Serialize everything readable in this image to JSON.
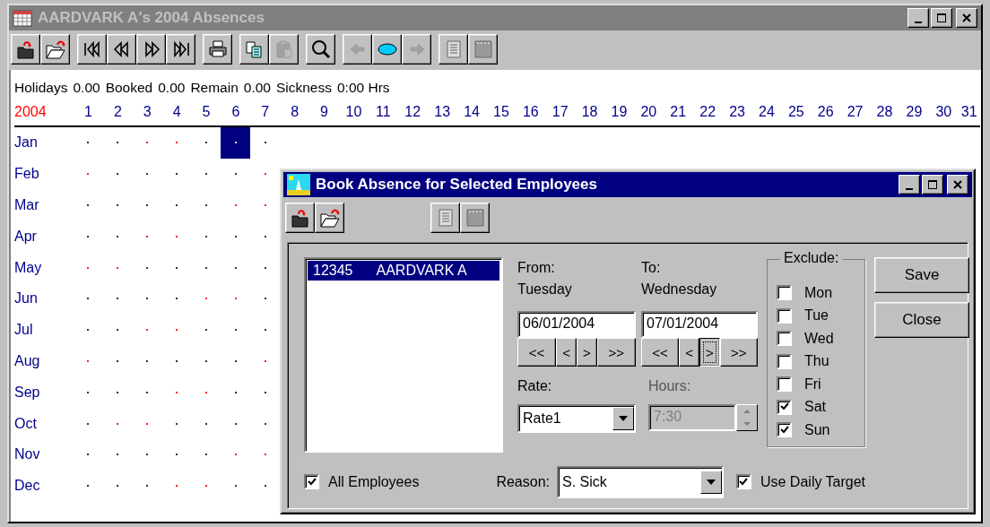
{
  "window": {
    "title": "AARDVARK A's 2004 Absences",
    "active": false
  },
  "toolbar": [
    [
      {
        "disabled": false
      },
      {
        "disabled": false
      }
    ],
    [
      {
        "disabled": false
      },
      {
        "disabled": false
      },
      {
        "disabled": false
      },
      {
        "disabled": false
      }
    ],
    [
      {
        "disabled": false
      }
    ],
    [
      {
        "disabled": false
      },
      {
        "disabled": true
      }
    ],
    [
      {
        "disabled": false
      }
    ],
    [
      {
        "disabled": true
      },
      {
        "disabled": false
      },
      {
        "disabled": true
      }
    ],
    [
      {
        "disabled": false
      },
      {
        "disabled": false
      }
    ]
  ],
  "summary": [
    {
      "label": "Holidays",
      "value": "0.00"
    },
    {
      "label": "Booked",
      "value": "0.00"
    },
    {
      "label": "Remain",
      "value": "0.00"
    },
    {
      "label": "Sickness",
      "value": "0:00 Hrs"
    }
  ],
  "calendar": {
    "year": "2004",
    "days": [
      "1",
      "2",
      "3",
      "4",
      "5",
      "6",
      "7",
      "8",
      "9",
      "10",
      "11",
      "12",
      "13",
      "14",
      "15",
      "16",
      "17",
      "18",
      "19",
      "20",
      "21",
      "22",
      "23",
      "24",
      "25",
      "26",
      "27",
      "28",
      "29",
      "30",
      "31"
    ],
    "months": [
      {
        "name": "Jan",
        "days": [
          {
            "weekend": false,
            "selected": false
          },
          {
            "weekend": false,
            "selected": false
          },
          {
            "weekend": true,
            "selected": false
          },
          {
            "weekend": true,
            "selected": false
          },
          {
            "weekend": false,
            "selected": false
          },
          {
            "weekend": false,
            "selected": true
          },
          {
            "weekend": false,
            "selected": false
          }
        ]
      },
      {
        "name": "Feb",
        "days": [
          {
            "weekend": true,
            "selected": false
          },
          {
            "weekend": false,
            "selected": false
          },
          {
            "weekend": false,
            "selected": false
          },
          {
            "weekend": false,
            "selected": false
          },
          {
            "weekend": false,
            "selected": false
          },
          {
            "weekend": false,
            "selected": false
          },
          {
            "weekend": true,
            "selected": false
          }
        ]
      },
      {
        "name": "Mar",
        "days": [
          {
            "weekend": false,
            "selected": false
          },
          {
            "weekend": false,
            "selected": false
          },
          {
            "weekend": false,
            "selected": false
          },
          {
            "weekend": false,
            "selected": false
          },
          {
            "weekend": false,
            "selected": false
          },
          {
            "weekend": true,
            "selected": false
          },
          {
            "weekend": true,
            "selected": false
          }
        ]
      },
      {
        "name": "Apr",
        "days": [
          {
            "weekend": false,
            "selected": false
          },
          {
            "weekend": false,
            "selected": false
          },
          {
            "weekend": true,
            "selected": false
          },
          {
            "weekend": true,
            "selected": false
          },
          {
            "weekend": false,
            "selected": false
          },
          {
            "weekend": false,
            "selected": false
          },
          {
            "weekend": false,
            "selected": false
          }
        ]
      },
      {
        "name": "May",
        "days": [
          {
            "weekend": true,
            "selected": false
          },
          {
            "weekend": true,
            "selected": false
          },
          {
            "weekend": false,
            "selected": false
          },
          {
            "weekend": false,
            "selected": false
          },
          {
            "weekend": false,
            "selected": false
          },
          {
            "weekend": false,
            "selected": false
          },
          {
            "weekend": false,
            "selected": false
          }
        ]
      },
      {
        "name": "Jun",
        "days": [
          {
            "weekend": false,
            "selected": false
          },
          {
            "weekend": false,
            "selected": false
          },
          {
            "weekend": false,
            "selected": false
          },
          {
            "weekend": false,
            "selected": false
          },
          {
            "weekend": true,
            "selected": false
          },
          {
            "weekend": true,
            "selected": false
          },
          {
            "weekend": false,
            "selected": false
          }
        ]
      },
      {
        "name": "Jul",
        "days": [
          {
            "weekend": false,
            "selected": false
          },
          {
            "weekend": false,
            "selected": false
          },
          {
            "weekend": true,
            "selected": false
          },
          {
            "weekend": true,
            "selected": false
          },
          {
            "weekend": false,
            "selected": false
          },
          {
            "weekend": false,
            "selected": false
          },
          {
            "weekend": false,
            "selected": false
          }
        ]
      },
      {
        "name": "Aug",
        "days": [
          {
            "weekend": true,
            "selected": false
          },
          {
            "weekend": false,
            "selected": false
          },
          {
            "weekend": false,
            "selected": false
          },
          {
            "weekend": false,
            "selected": false
          },
          {
            "weekend": false,
            "selected": false
          },
          {
            "weekend": false,
            "selected": false
          },
          {
            "weekend": true,
            "selected": false
          }
        ]
      },
      {
        "name": "Sep",
        "days": [
          {
            "weekend": false,
            "selected": false
          },
          {
            "weekend": false,
            "selected": false
          },
          {
            "weekend": false,
            "selected": false
          },
          {
            "weekend": true,
            "selected": false
          },
          {
            "weekend": true,
            "selected": false
          },
          {
            "weekend": false,
            "selected": false
          },
          {
            "weekend": false,
            "selected": false
          }
        ]
      },
      {
        "name": "Oct",
        "days": [
          {
            "weekend": false,
            "selected": false
          },
          {
            "weekend": true,
            "selected": false
          },
          {
            "weekend": true,
            "selected": false
          },
          {
            "weekend": false,
            "selected": false
          },
          {
            "weekend": false,
            "selected": false
          },
          {
            "weekend": false,
            "selected": false
          },
          {
            "weekend": false,
            "selected": false
          }
        ]
      },
      {
        "name": "Nov",
        "days": [
          {
            "weekend": false,
            "selected": false
          },
          {
            "weekend": false,
            "selected": false
          },
          {
            "weekend": false,
            "selected": false
          },
          {
            "weekend": false,
            "selected": false
          },
          {
            "weekend": false,
            "selected": false
          },
          {
            "weekend": true,
            "selected": false
          },
          {
            "weekend": true,
            "selected": false
          }
        ]
      },
      {
        "name": "Dec",
        "days": [
          {
            "weekend": false,
            "selected": false
          },
          {
            "weekend": false,
            "selected": false
          },
          {
            "weekend": false,
            "selected": false
          },
          {
            "weekend": true,
            "selected": false
          },
          {
            "weekend": true,
            "selected": false
          },
          {
            "weekend": false,
            "selected": false
          },
          {
            "weekend": false,
            "selected": false
          }
        ]
      }
    ]
  },
  "dialog": {
    "title": "Book Absence for Selected Employees",
    "active": true,
    "toolbar": [
      [
        {
          "disabled": false
        },
        {
          "disabled": false
        }
      ],
      [
        {
          "disabled": false
        },
        {
          "disabled": false
        }
      ]
    ],
    "employees": [
      {
        "id": "12345",
        "name": "AARDVARK A",
        "selected": true
      }
    ],
    "all_employees": {
      "label": "All Employees",
      "checked": true
    },
    "from": {
      "label": "From:",
      "day": "Tuesday",
      "value": "06/01/2004",
      "nav": [
        {
          "label": "<<",
          "focused": false
        },
        {
          "label": "<",
          "focused": false
        },
        {
          "label": ">",
          "focused": false
        },
        {
          "label": ">>",
          "focused": false
        }
      ]
    },
    "to": {
      "label": "To:",
      "day": "Wednesday",
      "value": "07/01/2004",
      "nav": [
        {
          "label": "<<",
          "focused": false
        },
        {
          "label": "<",
          "focused": false
        },
        {
          "label": ">",
          "focused": true
        },
        {
          "label": ">>",
          "focused": false
        }
      ]
    },
    "rate": {
      "label": "Rate:",
      "value": "Rate1"
    },
    "hours": {
      "label": "Hours:",
      "value": "7:30",
      "disabled": true
    },
    "exclude": {
      "label": "Exclude:",
      "days": [
        {
          "label": "Mon",
          "checked": false
        },
        {
          "label": "Tue",
          "checked": false
        },
        {
          "label": "Wed",
          "checked": false
        },
        {
          "label": "Thu",
          "checked": false
        },
        {
          "label": "Fri",
          "checked": false
        },
        {
          "label": "Sat",
          "checked": true
        },
        {
          "label": "Sun",
          "checked": true
        }
      ]
    },
    "buttons": [
      {
        "label": "Save"
      },
      {
        "label": "Close"
      }
    ],
    "reason": {
      "label": "Reason:",
      "value": "S. Sick"
    },
    "use_daily_target": {
      "label": "Use Daily Target",
      "checked": true
    }
  }
}
